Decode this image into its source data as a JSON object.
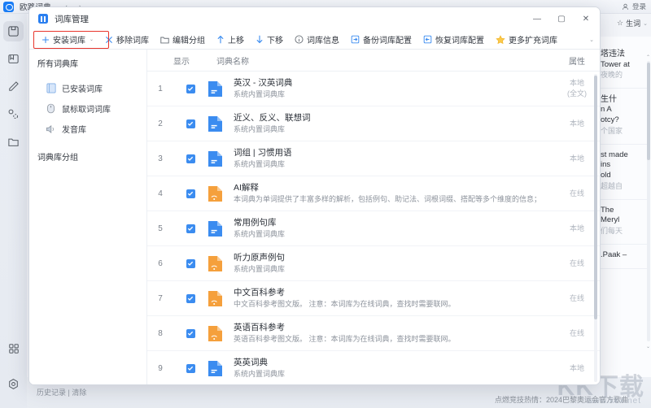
{
  "background": {
    "app_title": "欧路词典",
    "nav_back": "‹",
    "nav_forward": "›",
    "login_label": "登录",
    "toolbar_right": {
      "star_label": "生词"
    },
    "panel_entries": [
      {
        "zh": "塔违法",
        "en": "Tower at",
        "gray": "夜晚的"
      },
      {
        "zh": "生什",
        "en": "n A",
        "en2": "otcy?",
        "gray": "个国家"
      },
      {
        "en": "st made",
        "en2": "ins",
        "en3": "old",
        "gray": "超越自"
      },
      {
        "en": "The",
        "en2": " Meryl",
        "gray": "们每天"
      },
      {
        "en": ".Paak –"
      }
    ],
    "status": {
      "history": "历史记录 | 清除"
    },
    "news": "点燃竞技热情：2024巴黎奥运会官方歌曲",
    "watermark": {
      "main": "KK下载",
      "sub": "www.kkx.net"
    },
    "rail": [
      {
        "name": "save-icon",
        "glyph": "save"
      },
      {
        "name": "book-icon",
        "glyph": "book"
      },
      {
        "name": "pen-icon",
        "glyph": "pen"
      },
      {
        "name": "network-icon",
        "glyph": "network"
      },
      {
        "name": "folder-icon",
        "glyph": "folder"
      }
    ],
    "rail_bottom": [
      {
        "name": "apps-grid-icon"
      },
      {
        "name": "settings-icon"
      }
    ]
  },
  "dialog": {
    "title": "词库管理",
    "window_controls": {
      "minimize": "—",
      "maximize": "▢",
      "close": "✕"
    },
    "toolbar": [
      {
        "label": "安装词库",
        "icon": "plus-icon",
        "caret": "⌄",
        "highlighted": true
      },
      {
        "label": "移除词库",
        "icon": "close-x-icon"
      },
      {
        "label": "编辑分组",
        "icon": "folder-icon"
      },
      {
        "label": "上移",
        "icon": "arrow-up-icon"
      },
      {
        "label": "下移",
        "icon": "arrow-down-icon"
      },
      {
        "label": "词库信息",
        "icon": "info-icon"
      },
      {
        "label": "备份词库配置",
        "icon": "export-icon"
      },
      {
        "label": "恢复词库配置",
        "icon": "import-icon"
      },
      {
        "label": "更多扩充词库",
        "icon": "star-icon"
      }
    ],
    "sidebar": {
      "head": "所有词典库",
      "items": [
        {
          "label": "已安装词库",
          "icon": "book-blue-icon"
        },
        {
          "label": "鼠标取词词库",
          "icon": "mouse-icon"
        },
        {
          "label": "发音库",
          "icon": "speaker-icon"
        }
      ],
      "group_head": "词典库分组"
    },
    "table": {
      "headers": {
        "no": "",
        "show": "显示",
        "name": "词典名称",
        "attr": "属性"
      },
      "rows": [
        {
          "no": "1",
          "checked": true,
          "icon_color": "blue",
          "title": "英汉 - 汉英词典",
          "sub": "系统内置词典库",
          "attr": "本地",
          "attr2": "(全文)"
        },
        {
          "no": "2",
          "checked": true,
          "icon_color": "blue",
          "title": "近义、反义、联想词",
          "sub": "系统内置词典库",
          "attr": "本地",
          "attr2": ""
        },
        {
          "no": "3",
          "checked": true,
          "icon_color": "blue",
          "title": "词组 | 习惯用语",
          "sub": "系统内置词典库",
          "attr": "本地",
          "attr2": ""
        },
        {
          "no": "4",
          "checked": true,
          "icon_color": "orange",
          "title": "AI解释",
          "sub": "本词典为单词提供了丰富多样的解析，包括例句、助记法、词根词缀、搭配等多个维度的信息；",
          "attr": "在线",
          "attr2": ""
        },
        {
          "no": "5",
          "checked": true,
          "icon_color": "blue",
          "title": "常用例句库",
          "sub": "系统内置词典库",
          "attr": "本地",
          "attr2": ""
        },
        {
          "no": "6",
          "checked": true,
          "icon_color": "orange",
          "title": "听力原声例句",
          "sub": "系统内置词典库",
          "attr": "在线",
          "attr2": ""
        },
        {
          "no": "7",
          "checked": true,
          "icon_color": "orange",
          "title": "中文百科参考",
          "sub": "中文百科参考图文版。 注意：本词库为在线词典，查找时需要联网。",
          "attr": "在线",
          "attr2": ""
        },
        {
          "no": "8",
          "checked": true,
          "icon_color": "orange",
          "title": "英语百科参考",
          "sub": "英语百科参考图文版。 注意：本词库为在线词典，查找时需要联网。",
          "attr": "在线",
          "attr2": ""
        },
        {
          "no": "9",
          "checked": true,
          "icon_color": "blue",
          "title": "英英词典",
          "sub": "系统内置词典库",
          "attr": "本地",
          "attr2": ""
        }
      ]
    }
  },
  "colors": {
    "accent_blue": "#3b8cf0",
    "icon_orange": "#f5a03c",
    "highlight_red": "#e8352c"
  }
}
